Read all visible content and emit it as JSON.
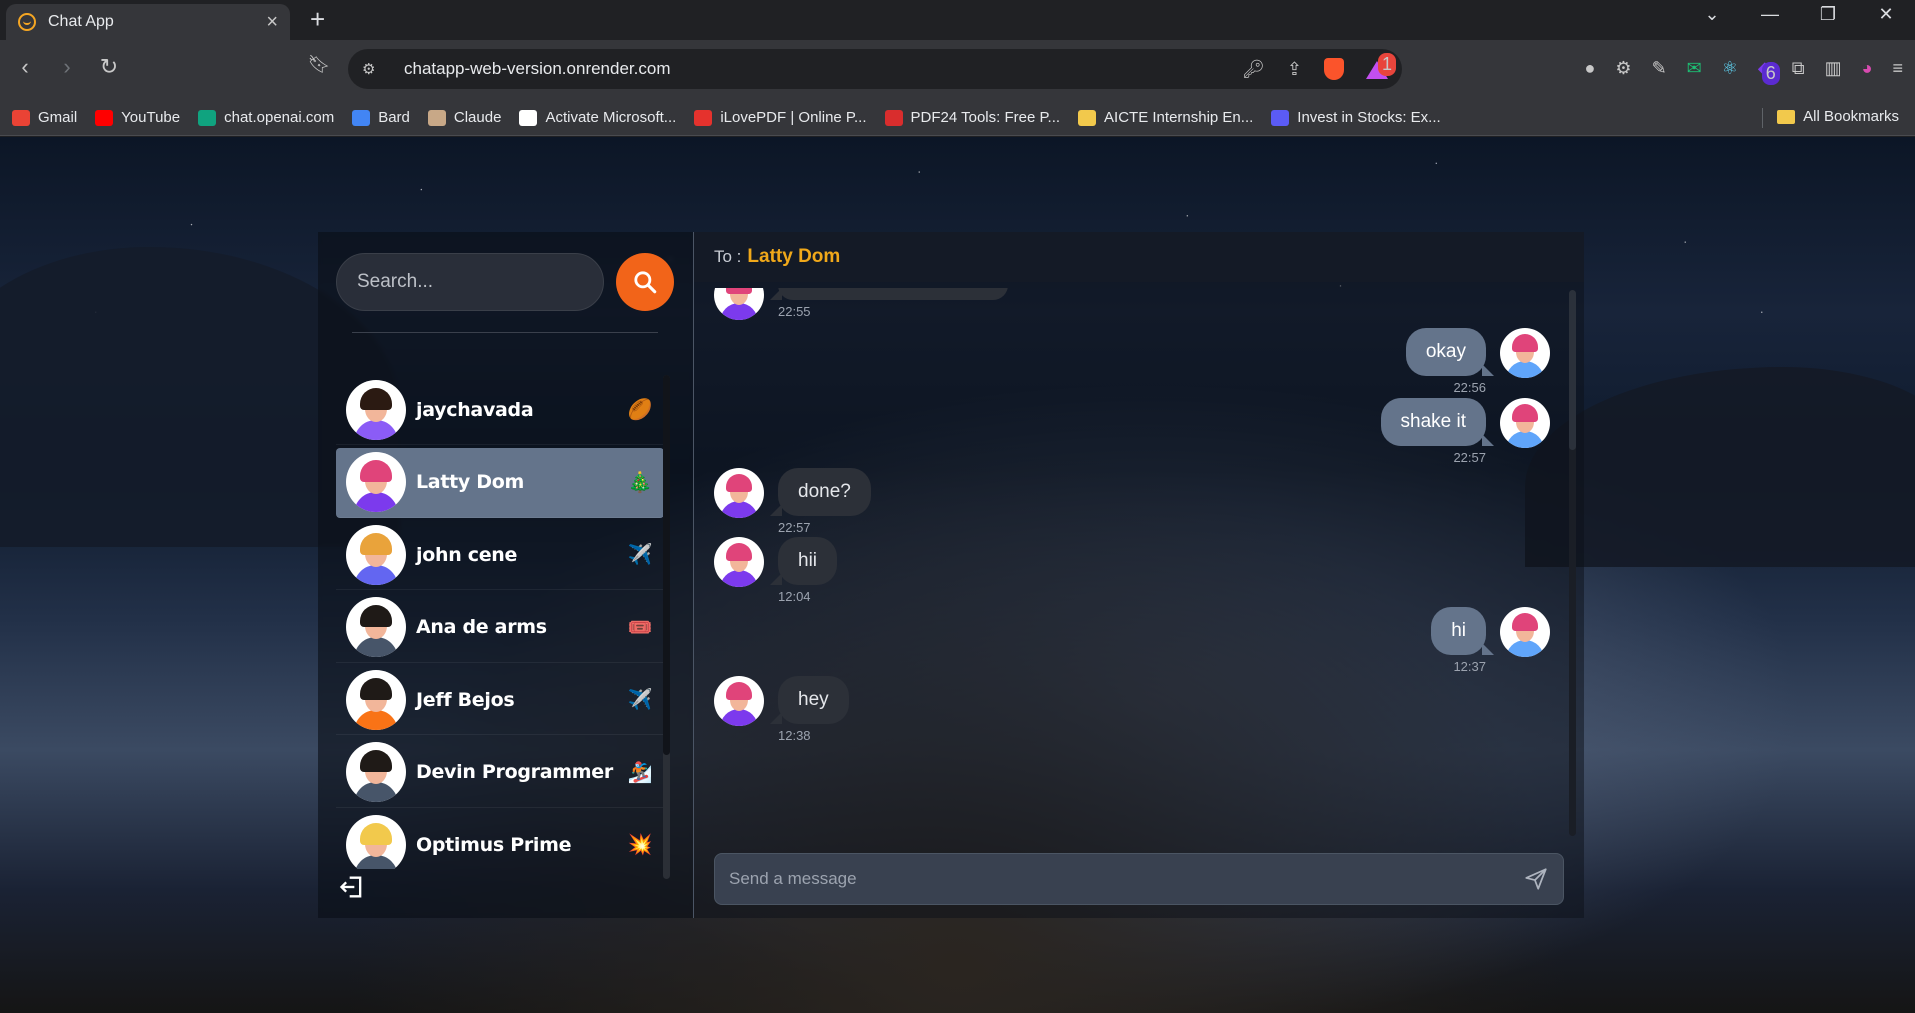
{
  "browser": {
    "tab_title": "Chat App",
    "url": "chatapp-web-version.onrender.com",
    "rewards_badge": "1",
    "ext_badge": "6",
    "bookmarks": [
      {
        "label": "Gmail",
        "color": "#ea4335"
      },
      {
        "label": "YouTube",
        "color": "#ff0000"
      },
      {
        "label": "chat.openai.com",
        "color": "#10a37f"
      },
      {
        "label": "Bard",
        "color": "#4285f4"
      },
      {
        "label": "Claude",
        "color": "#c8a887"
      },
      {
        "label": "Activate Microsoft...",
        "color": "#ffffff"
      },
      {
        "label": "iLovePDF | Online P...",
        "color": "#e5322d"
      },
      {
        "label": "PDF24 Tools: Free P...",
        "color": "#d92d2d"
      },
      {
        "label": "AICTE Internship En...",
        "color": "#f2c94c"
      },
      {
        "label": "Invest in Stocks: Ex...",
        "color": "#5b5bf5"
      }
    ],
    "all_bookmarks": "All Bookmarks"
  },
  "sidebar": {
    "search_placeholder": "Search...",
    "conversations": [
      {
        "name": "jaychavada",
        "emoji": "🏉",
        "hair": "#2b1a12",
        "body": "#8b5cf6",
        "selected": false
      },
      {
        "name": "Latty Dom",
        "emoji": "🎄",
        "hair": "#e0447a",
        "body": "#7c3aed",
        "selected": true
      },
      {
        "name": "john cene",
        "emoji": "✈️",
        "hair": "#e9a33b",
        "body": "#6366f1",
        "selected": false
      },
      {
        "name": "Ana de arms",
        "emoji": "🎟️",
        "hair": "#1f1a17",
        "body": "#475569",
        "selected": false
      },
      {
        "name": "Jeff Bejos",
        "emoji": "✈️",
        "hair": "#1f1a17",
        "body": "#f97316",
        "selected": false
      },
      {
        "name": "Devin Programmer",
        "emoji": "🏂",
        "hair": "#1f1a17",
        "body": "#475569",
        "selected": false
      },
      {
        "name": "Optimus Prime",
        "emoji": "💥",
        "hair": "#f2c94c",
        "body": "#475569",
        "selected": false
      }
    ]
  },
  "chat": {
    "to_label": "To :",
    "to_name": "Latty Dom",
    "messages": [
      {
        "dir": "in",
        "text": "",
        "time": "22:55",
        "partial": true
      },
      {
        "dir": "out",
        "text": "okay",
        "time": "22:56"
      },
      {
        "dir": "out",
        "text": "shake it",
        "time": "22:57"
      },
      {
        "dir": "in",
        "text": "done?",
        "time": "22:57"
      },
      {
        "dir": "in",
        "text": "hii",
        "time": "12:04"
      },
      {
        "dir": "out",
        "text": "hi",
        "time": "12:37"
      },
      {
        "dir": "in",
        "text": "hey",
        "time": "12:38"
      }
    ],
    "composer_placeholder": "Send a message"
  },
  "colors": {
    "accent": "#f26419",
    "recipient": "#f0a81a",
    "selected_row": "#64748b",
    "out_bubble": "#64748b",
    "in_bubble": "#2c3038"
  }
}
